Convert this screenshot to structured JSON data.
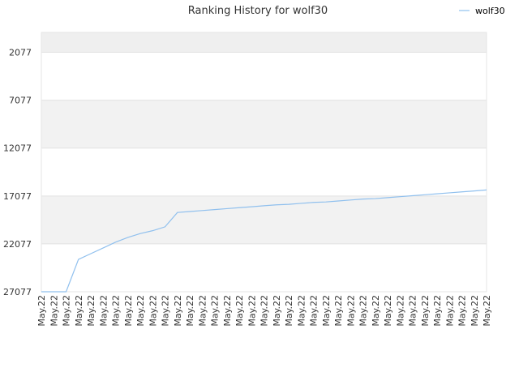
{
  "chart_data": {
    "type": "line",
    "title": "Ranking History for wolf30",
    "xlabel": "",
    "ylabel": "",
    "y_inverted": true,
    "ylim": [
      27077,
      0
    ],
    "y_ticks": [
      "2077",
      "7077",
      "12077",
      "17077",
      "22077",
      "27077"
    ],
    "y_tick_values": [
      2077,
      7077,
      12077,
      17077,
      22077,
      27077
    ],
    "grid": true,
    "legend": "top-right",
    "colors": {
      "series": "#90c0ee",
      "band": "#f2f2f2",
      "grid": "#e2e2e2"
    },
    "x": [
      "May.22",
      "May.22",
      "May.22",
      "May.22",
      "May.22",
      "May.22",
      "May.22",
      "May.22",
      "May.22",
      "May.22",
      "May.22",
      "May.22",
      "May.22",
      "May.22",
      "May.22",
      "May.22",
      "May.22",
      "May.22",
      "May.22",
      "May.22",
      "May.22",
      "May.22",
      "May.22",
      "May.22",
      "May.22",
      "May.22",
      "May.22",
      "May.22",
      "May.22",
      "May.22",
      "May.22",
      "May.22",
      "May.22",
      "May.22",
      "May.22",
      "May.22",
      "May.22"
    ],
    "series": [
      {
        "name": "wolf30",
        "values": [
          27077,
          27077,
          27077,
          23700,
          23100,
          22500,
          21900,
          21400,
          21000,
          20700,
          20300,
          18800,
          18700,
          18600,
          18500,
          18400,
          18300,
          18200,
          18100,
          18000,
          17950,
          17850,
          17750,
          17700,
          17600,
          17500,
          17400,
          17350,
          17250,
          17150,
          17050,
          16950,
          16850,
          16750,
          16650,
          16550,
          16450
        ]
      }
    ]
  }
}
